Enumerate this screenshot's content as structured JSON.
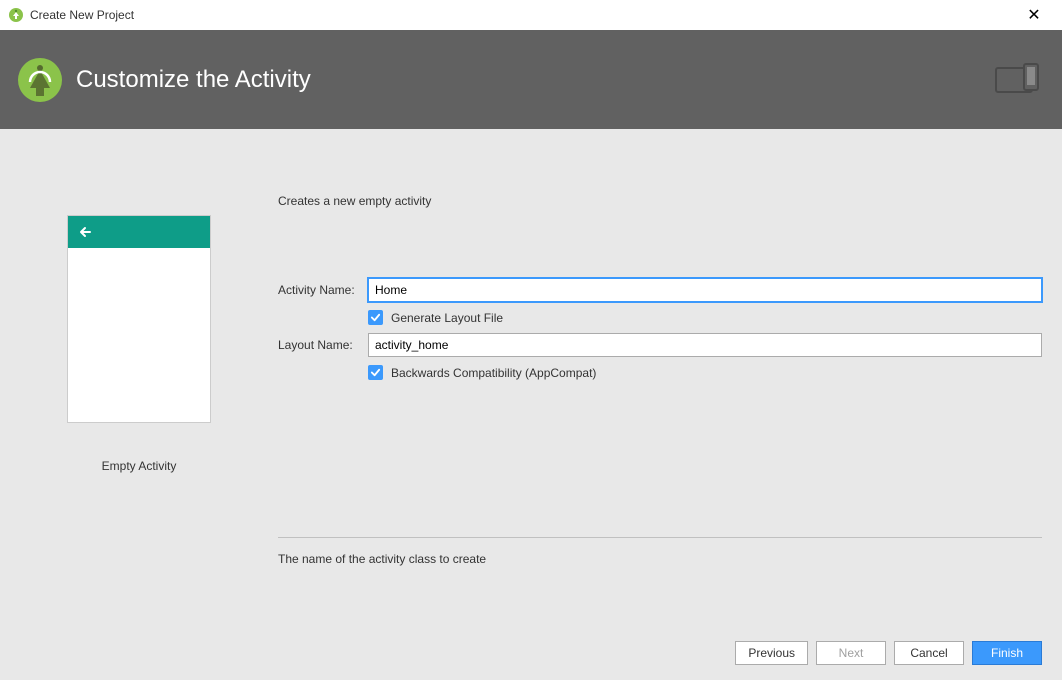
{
  "titlebar": {
    "title": "Create New Project"
  },
  "banner": {
    "title": "Customize the Activity"
  },
  "preview": {
    "label": "Empty Activity"
  },
  "form": {
    "subtitle": "Creates a new empty activity",
    "activity_name_label": "Activity Name:",
    "activity_name_value": "Home",
    "generate_layout_label": "Generate Layout File",
    "generate_layout_checked": true,
    "layout_name_label": "Layout Name:",
    "layout_name_value": "activity_home",
    "backwards_compat_label": "Backwards Compatibility (AppCompat)",
    "backwards_compat_checked": true,
    "help_text": "The name of the activity class to create"
  },
  "buttons": {
    "previous": "Previous",
    "next": "Next",
    "cancel": "Cancel",
    "finish": "Finish"
  }
}
